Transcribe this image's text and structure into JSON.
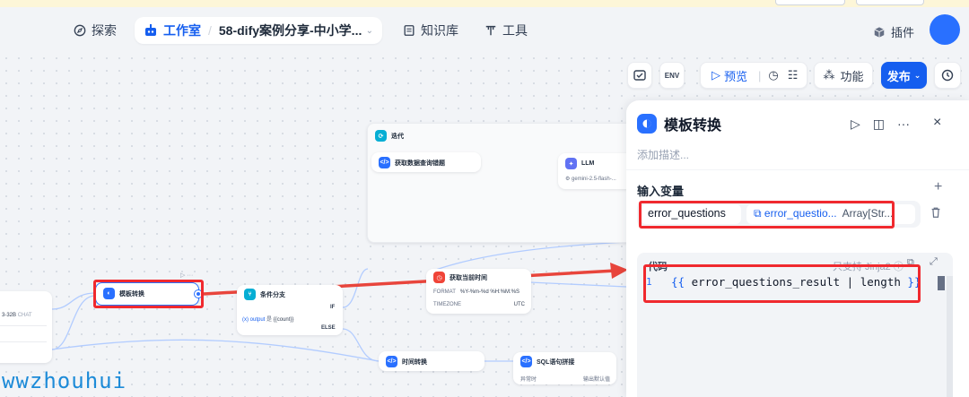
{
  "header": {
    "explore_label": "探索",
    "studio_label": "工作室",
    "app_name": "58-dify案例分享-中小学...",
    "knowledge_label": "知识库",
    "tools_label": "工具",
    "plugins_label": "插件"
  },
  "toolbar": {
    "env_label": "ENV",
    "preview_label": "预览",
    "features_label": "功能",
    "publish_label": "发布"
  },
  "nodes": {
    "iteration_title": "迭代",
    "fetch_questions_title": "获取数据查询错题",
    "llm_title": "LLM",
    "llm_model": "gemini-2.5-flash-...",
    "get_time_title": "获取当前时间",
    "format_key": "FORMAT",
    "format_value": "%Y-%m-%d %H:%M:%S",
    "timezone_key": "TIMEZONE",
    "timezone_value": "UTC",
    "template_node_title": "模板转换",
    "if_else_title": "条件分支",
    "if_label": "IF",
    "condition_var": "output",
    "condition_op": "是",
    "condition_value": "{{count}}",
    "else_label": "ELSE",
    "start_model": "3-32B",
    "start_badge": "CHAT",
    "time_convert_title": "时间转换",
    "sql_title": "SQL语句拼接",
    "sql_row_key": "异常时",
    "sql_row_value": "输出默认值"
  },
  "panel": {
    "title": "模板转换",
    "description_placeholder": "添加描述...",
    "input_vars_label": "输入变量",
    "var_name": "error_questions",
    "var_ref": "error_questio...",
    "var_type": "Array[Str...",
    "code_label": "代码",
    "jinja_hint": "只支持 Jinja2",
    "line_number": "1",
    "code_open": "{{",
    "code_body": " error_questions_result | length ",
    "code_close": "}}"
  },
  "watermark": "wwzhouhui",
  "colors": {
    "accent": "#155eef",
    "highlight": "#f0292e",
    "arrow": "#e8453c"
  }
}
